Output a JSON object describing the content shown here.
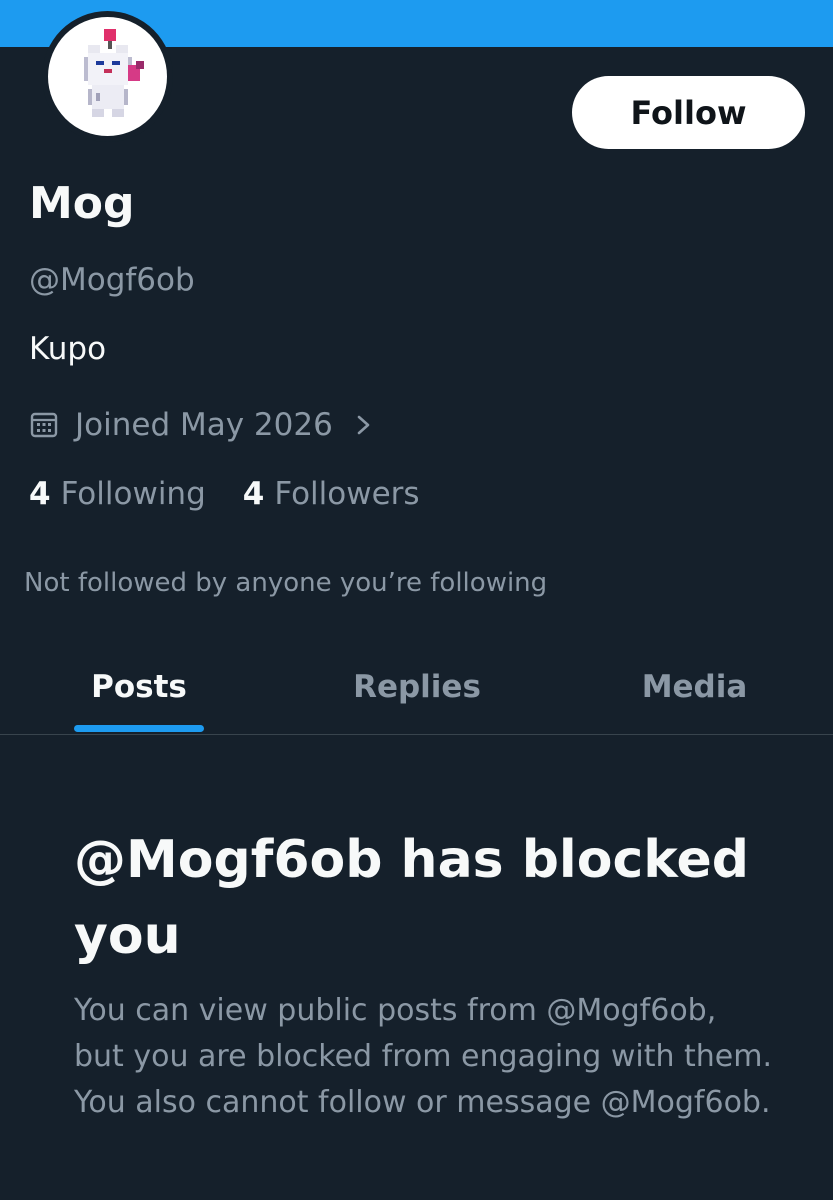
{
  "profile": {
    "display_name": "Mog",
    "handle": "@Mogf6ob",
    "bio": "Kupo",
    "joined": "Joined May 2026",
    "following_count": "4",
    "following_label": "Following",
    "followers_count": "4",
    "followers_label": "Followers",
    "mutual_text": "Not followed by anyone you’re following"
  },
  "actions": {
    "follow_label": "Follow"
  },
  "tabs": [
    {
      "label": "Posts",
      "active": true
    },
    {
      "label": "Replies",
      "active": false
    },
    {
      "label": "Media",
      "active": false
    }
  ],
  "blocked": {
    "title": "@Mogf6ob has blocked you",
    "description": "You can view public posts from @Mogf6ob, but you are blocked from engaging with them. You also cannot follow or message @Mogf6ob."
  },
  "icons": {
    "calendar": "calendar-icon",
    "chevron": "chevron-right-icon"
  },
  "colors": {
    "background": "#15202b",
    "accent": "#1d9bf0",
    "primary_text": "#f7f9f9",
    "secondary_text": "#8b98a5",
    "divider": "#38444d",
    "button_bg": "#ffffff"
  }
}
